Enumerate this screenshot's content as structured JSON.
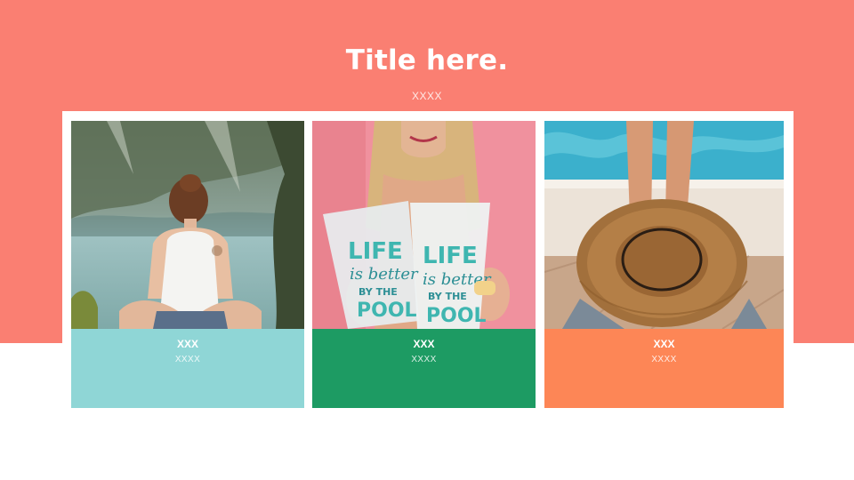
{
  "header": {
    "title": "Title here.",
    "subtitle": "XXXX"
  },
  "cards": [
    {
      "title": "XXX",
      "subtitle": "XXXX",
      "color": "#8fd6d6",
      "photo": "woman-at-lake-photo"
    },
    {
      "title": "XXX",
      "subtitle": "XXXX",
      "color": "#1d9b63",
      "photo": "pool-cups-photo",
      "cup_text": [
        "LIFE",
        "is better",
        "BY THE",
        "POOL"
      ]
    },
    {
      "title": "XXX",
      "subtitle": "XXXX",
      "color": "#fd8656",
      "photo": "straw-hat-poolside-photo"
    }
  ],
  "colors": {
    "band": "#fa7f72",
    "background": "#ffffff"
  }
}
